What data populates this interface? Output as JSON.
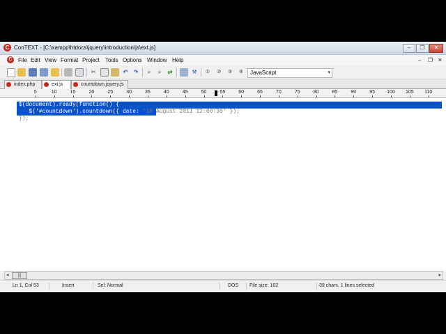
{
  "window": {
    "title": "ConTEXT - [C:\\xampp\\htdocs\\jquery\\introduction\\js\\ext.js]",
    "app_icon_letter": "C"
  },
  "menu": {
    "items": [
      "File",
      "Edit",
      "View",
      "Format",
      "Project",
      "Tools",
      "Options",
      "Window",
      "Help"
    ]
  },
  "toolbar": {
    "language": "JavaScript"
  },
  "tabs": [
    {
      "label": "index.php",
      "active": false
    },
    {
      "label": "ext.js",
      "active": true
    },
    {
      "label": "countdown.jquery.js",
      "active": false
    }
  ],
  "ruler": {
    "labels": [
      "5",
      "10",
      "15",
      "20",
      "25",
      "30",
      "35",
      "40",
      "45",
      "50",
      "55",
      "60",
      "65",
      "70",
      "75",
      "80",
      "85",
      "90",
      "95",
      "100",
      "105",
      "110"
    ]
  },
  "editor": {
    "lines": [
      "$(document).ready(function() {",
      "   $('#countdown').countdown({ date: '10 August 2011 12:00:30' });",
      "});"
    ]
  },
  "status": {
    "position": "Ln 1, Col 53",
    "mode": "Insert",
    "selection_mode": "Sel: Normal",
    "line_ending": "DOS",
    "file_size": "File size: 102",
    "selection_info": "39 chars, 1 lines selected"
  },
  "colors": {
    "selection": "#0a52c8",
    "code_text": "#7a7a7a",
    "selected_text": "#ffffff"
  }
}
